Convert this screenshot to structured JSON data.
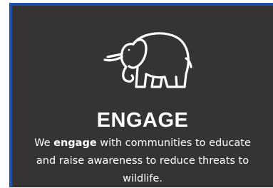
{
  "card": {
    "icon": "elephant-icon",
    "heading": "ENGAGE",
    "body": {
      "line1_pre": "We ",
      "line1_bold": "engage",
      "line1_post": " with communities to educate",
      "line2": "and raise awareness to reduce threats to",
      "line3": "wildlife."
    },
    "colors": {
      "background": "#353433",
      "accent_border": "#1f4fa8",
      "text": "#ffffff"
    }
  }
}
